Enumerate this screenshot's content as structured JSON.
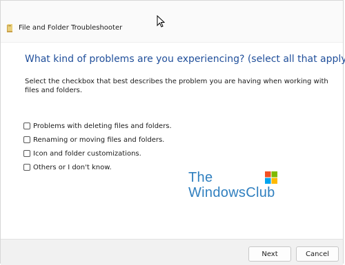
{
  "window": {
    "title": "File and Folder Troubleshooter"
  },
  "content": {
    "heading": "What kind of problems are you experiencing? (select all that apply)",
    "description": "Select the checkbox that best describes the problem you are having when working with files and folders.",
    "options": [
      {
        "label": "Problems with deleting files and folders.",
        "checked": false
      },
      {
        "label": "Renaming or moving files and folders.",
        "checked": false
      },
      {
        "label": "Icon and folder customizations.",
        "checked": false
      },
      {
        "label": "Others or I don't know.",
        "checked": false
      }
    ]
  },
  "watermark": {
    "line1": "The",
    "line2": "WindowsClub"
  },
  "footer": {
    "next_label": "Next",
    "cancel_label": "Cancel"
  },
  "colors": {
    "heading": "#1f4e9a",
    "watermark": "#2f7fbf"
  }
}
